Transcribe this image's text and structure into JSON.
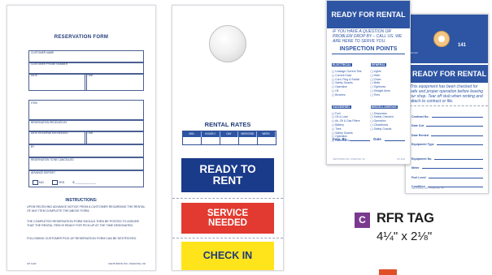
{
  "reservation_form": {
    "title": "RESERVATION FORM",
    "fields": {
      "customer_name": "CUSTOMER NAME",
      "customer_phone": "CUSTOMER PHONE NUMBER",
      "date": "DATE",
      "time": "TIME",
      "item": "ITEM",
      "reservation_received_by": "RESERVATION RECEIVED BY",
      "date_reservation_needed": "DATE RESERVATION NEEDED",
      "time2": "TIME",
      "by": "BY",
      "reservation_cancelled": "RESERVATION TO BE CANCELLED",
      "advance_deposit": "ADVANCE DEPOSIT",
      "no": "NO",
      "yes": "YES",
      "dollar": "$"
    },
    "instructions_title": "INSTRUCTIONS:",
    "instructions": [
      "UPON RECEIVING ADVANCE NOTICE FROM A CUSTOMER REGARDING THE RENTAL OF ANY ITEM COMPLETE THE ABOVE FORM.",
      "THE COMPLETED RESERVATION FORM SHOULD THEN BE POSTED TO ASSURE THAT THE RENTAL ITEM IS READY FOR PICK-UP AT THE TIME DESIGNATED.",
      "FOLLOWING CUSTOMER PICK-UP RESERVATION FORM CAN BE DESTROYED."
    ],
    "footer_left": "CP 1143",
    "footer_right": "CENTURION INC. OSHKOSH, WI"
  },
  "middle_tag": {
    "rates_title": "RENTAL RATES",
    "rates_columns": [
      "MIN.",
      "HOURLY",
      "DAY",
      "WEEKEND",
      "WEEK"
    ],
    "band_ready": [
      "READY TO",
      "RENT"
    ],
    "band_service": [
      "SERVICE",
      "NEEDED"
    ],
    "band_check": "CHECK IN"
  },
  "right_tag_front": {
    "title": "READY FOR RENTAL",
    "question": "IF YOU HAVE A QUESTION OR PROBLEM DROP BY – CALL US. WE ARE HERE TO SERVE YOU.",
    "inspection_title": "INSPECTION POINTS",
    "col1_sections": [
      {
        "heading": "ELECTRICAL",
        "items": [
          "Leakage Current Test",
          "Current Draw",
          "Cord, Plug & Switch",
          "Safety Guards",
          "Operation"
        ]
      },
      {
        "heading": "",
        "items": [
          "Oil",
          "Brushes"
        ]
      },
      {
        "heading": "GAS/DIESEL",
        "items": [
          "Fuel",
          "Oil & Lube",
          "Air, Oil & Gas Filters",
          "Battery",
          "Tires",
          "Safety Guards",
          "Operation",
          "Cleanliness"
        ]
      }
    ],
    "col2_sections": [
      {
        "heading": "GENERAL",
        "items": [
          "Lights",
          "Hitch",
          "Chain",
          "Belts",
          "Tightness",
          "Straight Arms",
          "Tires"
        ]
      },
      {
        "heading": "MISCELLANEOUS",
        "items": [
          "Sharpness",
          "Safety Checked",
          "Operation",
          "Cleanliness",
          "Safety Guards"
        ]
      }
    ],
    "insp_by": "Insp. By",
    "date": "Date",
    "footer_left": "CENTURION INC. OSHKOSH, WI",
    "footer_right": "CP 1144"
  },
  "right_tag_back": {
    "number": "141",
    "rental_label": "Rental",
    "title": "READY FOR RENTAL",
    "body": "This equipment has been checked for safe and proper operation before leaving our shop. Tear off stub when renting and attach to contract or file.",
    "fields": [
      "Contract No.",
      "Date Out",
      "Date Rented",
      "Equipment Type",
      "Equipment No.",
      "Meter",
      "Fuel Level",
      "Condition"
    ],
    "footer": "CENTURION INC. OSHKOSH, WI"
  },
  "product_label": {
    "badge": "C",
    "name": "RFR TAG",
    "size": "4¼\" x 2⅛\""
  },
  "colors": {
    "navy": "#1a3a8a",
    "blue": "#2e55a3",
    "red": "#e23a30",
    "yellow": "#ffe41c",
    "purple": "#7a3a90"
  }
}
